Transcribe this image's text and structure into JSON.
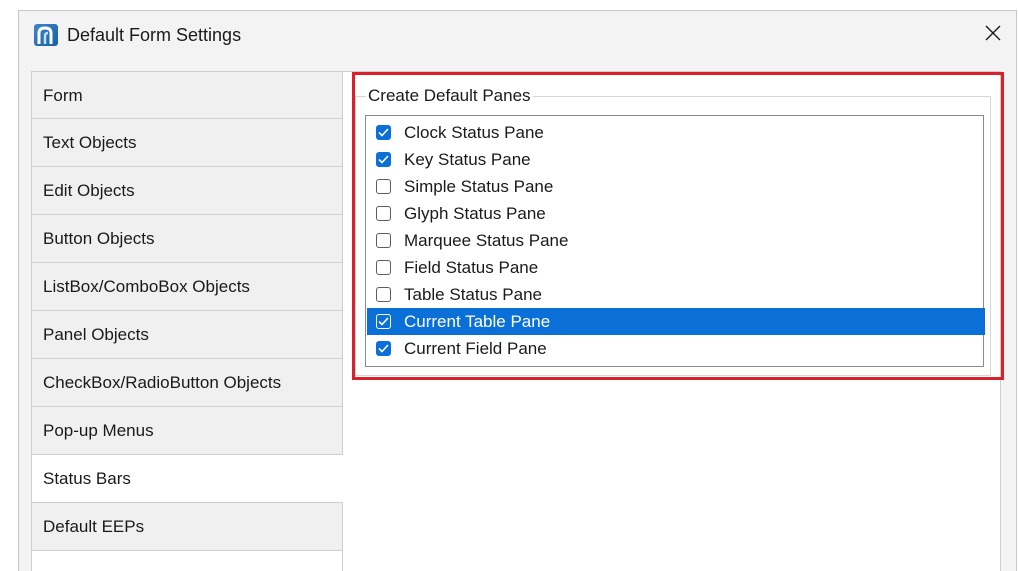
{
  "window": {
    "title": "Default Form Settings",
    "app_icon": "app-logo-icon",
    "close_icon": "close-icon"
  },
  "tabs": [
    {
      "label": "Form",
      "selected": false
    },
    {
      "label": "Text Objects",
      "selected": false
    },
    {
      "label": "Edit Objects",
      "selected": false
    },
    {
      "label": "Button Objects",
      "selected": false
    },
    {
      "label": "ListBox/ComboBox Objects",
      "selected": false
    },
    {
      "label": "Panel Objects",
      "selected": false
    },
    {
      "label": "CheckBox/RadioButton Objects",
      "selected": false
    },
    {
      "label": "Pop-up Menus",
      "selected": false
    },
    {
      "label": "Status Bars",
      "selected": true
    },
    {
      "label": "Default EEPs",
      "selected": false
    }
  ],
  "panes_group": {
    "legend": "Create Default Panes",
    "items": [
      {
        "label": "Clock Status Pane",
        "checked": true,
        "selected": false
      },
      {
        "label": "Key Status Pane",
        "checked": true,
        "selected": false
      },
      {
        "label": "Simple Status Pane",
        "checked": false,
        "selected": false
      },
      {
        "label": "Glyph Status Pane",
        "checked": false,
        "selected": false
      },
      {
        "label": "Marquee Status Pane",
        "checked": false,
        "selected": false
      },
      {
        "label": "Field Status Pane",
        "checked": false,
        "selected": false
      },
      {
        "label": "Table Status Pane",
        "checked": false,
        "selected": false
      },
      {
        "label": "Current Table Pane",
        "checked": true,
        "selected": true
      },
      {
        "label": "Current Field Pane",
        "checked": true,
        "selected": false
      }
    ]
  },
  "colors": {
    "accent": "#0a6fd6",
    "highlight_outline": "#d9202b",
    "window_bg": "#f3f3f3"
  }
}
